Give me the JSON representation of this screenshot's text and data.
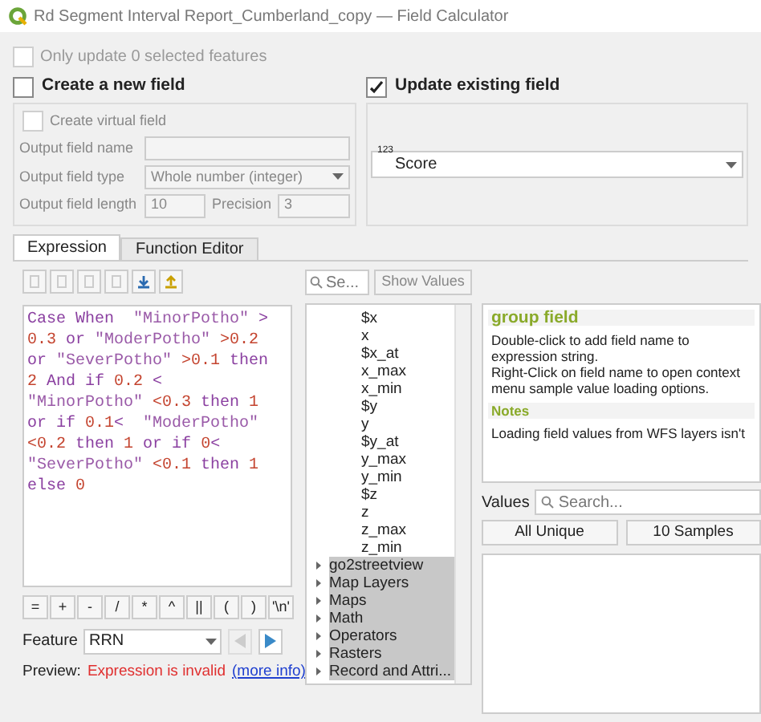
{
  "window": {
    "title": "Rd Segment Interval Report_Cumberland_copy — Field Calculator"
  },
  "only_selected": {
    "label": "Only update 0 selected features",
    "checked": false,
    "disabled": true
  },
  "create_field": {
    "label": "Create a new field",
    "checked": false,
    "virtual": {
      "label": "Create virtual field",
      "checked": false
    },
    "name": {
      "label": "Output field name"
    },
    "type": {
      "label": "Output field type",
      "value": "Whole number (integer)"
    },
    "length": {
      "label": "Output field length",
      "value": "10"
    },
    "precision": {
      "label": "Precision",
      "value": "3"
    }
  },
  "update_field": {
    "label": "Update existing field",
    "checked": true,
    "type_badge": "123",
    "value": "Score"
  },
  "tabs": [
    {
      "label": "Expression",
      "selected": true
    },
    {
      "label": "Function Editor",
      "selected": false
    }
  ],
  "expression_lines": [
    [
      {
        "text": "Case When  ",
        "kind": "keyword"
      },
      {
        "text": "\"MinorPotho\"",
        "kind": "string"
      },
      {
        "text": " >",
        "kind": "keyword"
      }
    ],
    [
      {
        "text": "0.3",
        "kind": "number"
      },
      {
        "text": " or ",
        "kind": "keyword"
      },
      {
        "text": "\"ModerPotho\"",
        "kind": "string"
      },
      {
        "text": " >0.2",
        "kind": "number"
      }
    ],
    [
      {
        "text": "or ",
        "kind": "keyword"
      },
      {
        "text": "\"SeverPotho\"",
        "kind": "string"
      },
      {
        "text": " >0.1",
        "kind": "number"
      },
      {
        "text": " then",
        "kind": "keyword"
      }
    ],
    [
      {
        "text": "2",
        "kind": "number"
      },
      {
        "text": " And if ",
        "kind": "keyword"
      },
      {
        "text": "0.2",
        "kind": "number"
      },
      {
        "text": " <",
        "kind": "keyword"
      }
    ],
    [
      {
        "text": "\"MinorPotho\"",
        "kind": "string"
      },
      {
        "text": " <0.3",
        "kind": "number"
      },
      {
        "text": " then",
        "kind": "keyword"
      },
      {
        "text": " 1",
        "kind": "number"
      }
    ],
    [
      {
        "text": "or if ",
        "kind": "keyword"
      },
      {
        "text": "0.1",
        "kind": "number"
      },
      {
        "text": "<  ",
        "kind": "keyword"
      },
      {
        "text": "\"ModerPotho\"",
        "kind": "string"
      }
    ],
    [
      {
        "text": "<0.2",
        "kind": "number"
      },
      {
        "text": " then",
        "kind": "keyword"
      },
      {
        "text": " 1",
        "kind": "number"
      },
      {
        "text": " or if ",
        "kind": "keyword"
      },
      {
        "text": "0",
        "kind": "number"
      },
      {
        "text": "<",
        "kind": "keyword"
      }
    ],
    [
      {
        "text": "\"SeverPotho\"",
        "kind": "string"
      },
      {
        "text": " <0.1",
        "kind": "number"
      },
      {
        "text": " then",
        "kind": "keyword"
      },
      {
        "text": " 1",
        "kind": "number"
      }
    ],
    [
      {
        "text": "else",
        "kind": "keyword"
      },
      {
        "text": " 0",
        "kind": "number"
      }
    ]
  ],
  "operators": [
    "=",
    "+",
    "-",
    "/",
    "*",
    "^",
    "||",
    "(",
    ")",
    "'\\n'"
  ],
  "feature": {
    "label": "Feature",
    "value": "RRN"
  },
  "preview": {
    "label": "Preview:",
    "message": "Expression is invalid",
    "link": "(more info)"
  },
  "search": {
    "placeholder": "Se..."
  },
  "show_values": "Show Values",
  "tree": [
    {
      "label": "$x",
      "kind": "field"
    },
    {
      "label": "x",
      "kind": "field"
    },
    {
      "label": "$x_at",
      "kind": "field"
    },
    {
      "label": "x_max",
      "kind": "field"
    },
    {
      "label": "x_min",
      "kind": "field"
    },
    {
      "label": "$y",
      "kind": "field"
    },
    {
      "label": "y",
      "kind": "field"
    },
    {
      "label": "$y_at",
      "kind": "field"
    },
    {
      "label": "y_max",
      "kind": "field"
    },
    {
      "label": "y_min",
      "kind": "field"
    },
    {
      "label": "$z",
      "kind": "field"
    },
    {
      "label": "z",
      "kind": "field"
    },
    {
      "label": "z_max",
      "kind": "field"
    },
    {
      "label": "z_min",
      "kind": "field"
    },
    {
      "label": "go2streetview",
      "kind": "group",
      "expanded": false
    },
    {
      "label": "Map Layers",
      "kind": "group",
      "expanded": false
    },
    {
      "label": "Maps",
      "kind": "group",
      "expanded": false
    },
    {
      "label": "Math",
      "kind": "group",
      "expanded": false
    },
    {
      "label": "Operators",
      "kind": "group",
      "expanded": false
    },
    {
      "label": "Rasters",
      "kind": "group",
      "expanded": false
    },
    {
      "label": "Record and Attri...",
      "kind": "group",
      "expanded": false
    }
  ],
  "help": {
    "title": "group field",
    "body": "Double-click to add field name to expression string.\nRight-Click on field name to open context menu sample value loading options.",
    "notes_title": "Notes",
    "notes": "Loading field values from WFS layers isn't"
  },
  "values": {
    "label": "Values",
    "placeholder": "Search...",
    "buttons": [
      "All Unique",
      "10 Samples"
    ]
  }
}
